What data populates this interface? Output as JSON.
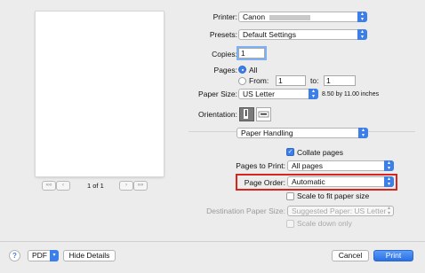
{
  "preview": {
    "first_label": "««",
    "prev_label": "‹",
    "page_indicator": "1 of 1",
    "next_label": "›",
    "last_label": "»»"
  },
  "printer": {
    "label": "Printer:",
    "value": "Canon"
  },
  "presets": {
    "label": "Presets:",
    "value": "Default Settings"
  },
  "copies": {
    "label": "Copies:",
    "value": "1"
  },
  "pages": {
    "label": "Pages:",
    "all_label": "All",
    "from_label": "From:",
    "from_value": "1",
    "to_label": "to:",
    "to_value": "1"
  },
  "paper_size": {
    "label": "Paper Size:",
    "value": "US Letter",
    "dimensions": "8.50 by 11.00 inches"
  },
  "orientation": {
    "label": "Orientation:"
  },
  "section": {
    "value": "Paper Handling"
  },
  "collate": {
    "label": "Collate pages",
    "checked": true
  },
  "pages_to_print": {
    "label": "Pages to Print:",
    "value": "All pages"
  },
  "page_order": {
    "label": "Page Order:",
    "value": "Automatic",
    "highlight_color": "#d9261c"
  },
  "scale_to_fit": {
    "label": "Scale to fit paper size",
    "checked": false
  },
  "destination_paper": {
    "label": "Destination Paper Size:",
    "value": "Suggested Paper: US Letter"
  },
  "scale_down": {
    "label": "Scale down only"
  },
  "footer": {
    "help_label": "?",
    "pdf_label": "PDF",
    "hide_details_label": "Hide Details",
    "cancel_label": "Cancel",
    "print_label": "Print"
  },
  "colors": {
    "accent": "#3d7fe9",
    "background": "#ececec"
  }
}
